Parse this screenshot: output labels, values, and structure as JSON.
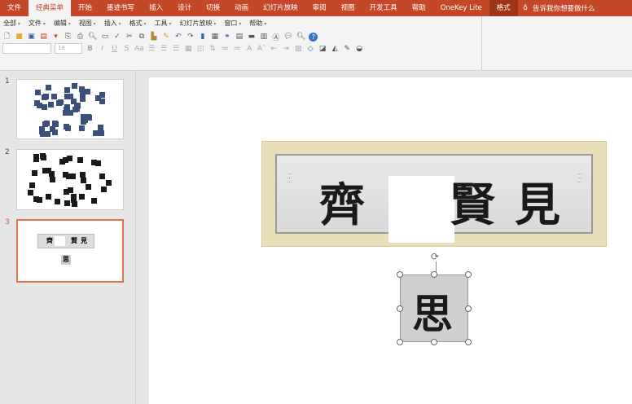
{
  "tabs": [
    "文件",
    "经典菜单",
    "开始",
    "墨迹书写",
    "插入",
    "设计",
    "切换",
    "动画",
    "幻灯片放映",
    "审阅",
    "视图",
    "开发工具",
    "帮助",
    "OneKey Lite",
    "格式"
  ],
  "active_tab": "经典菜单",
  "tell_me": "告诉我你想要做什么",
  "menu": [
    "全部",
    "文件",
    "编辑",
    "视图",
    "插入",
    "格式",
    "工具",
    "幻灯片放映",
    "窗口",
    "帮助"
  ],
  "toolbar": {
    "font_name": "",
    "font_size": "18",
    "bold": "B",
    "italic": "I",
    "underline": "U",
    "strike": "S",
    "case": "Aa"
  },
  "slides": [
    {
      "number": "1"
    },
    {
      "number": "2"
    },
    {
      "number": "3",
      "selected": true
    }
  ],
  "slide": {
    "banner_chars": [
      "齊",
      "賢",
      "見"
    ],
    "picture_char": "思"
  },
  "colors": {
    "accent": "#c4472a",
    "selected_thumb": "#e0734f"
  }
}
